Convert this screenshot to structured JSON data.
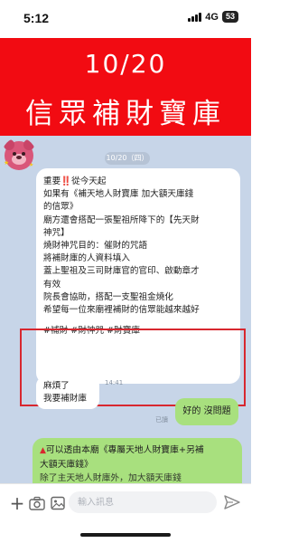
{
  "status_bar": {
    "time": "5:12",
    "network": "4G",
    "battery": "53"
  },
  "banner": {
    "date": "10/20",
    "title": "信眾補財寶庫",
    "background": "#f20b12"
  },
  "chat": {
    "date_label": "10/20（四）",
    "incoming_message": {
      "lines": [
        "重要‼️從今天起",
        "如果有《補天地人財寶庫 加大額天庫錢",
        "的信眾》",
        "廟方還會搭配一張聖祖所降下的【先天財",
        "神咒】",
        "燒財神咒目的：催財的咒語",
        "將補財庫的人資料填入",
        "蓋上聖祖及三司財庫官的官印、啟動章才",
        "有效",
        "院長會協助，搭配一支聖祖金燒化",
        "希望每一位來廟裡補財的信眾能越來越好",
        "#補財 #財神咒 #財寶庫"
      ]
    },
    "incoming_short": {
      "lines": [
        "麻煩了",
        "我要補財庫"
      ],
      "time": "14:41"
    },
    "outgoing_reply": {
      "text": "好的 沒問題",
      "status": "已讀"
    },
    "outgoing_long": {
      "lines": [
        "可以透由本廟《專屬天地人財寶庫+另補",
        "大額天庫錢》",
        "除了主天地人財庫外，加大額天庫錢"
      ]
    },
    "colors": {
      "background": "#c7d5e8",
      "outgoing_bubble": "#a8e07e",
      "highlight": "#d8272f"
    }
  },
  "input_bar": {
    "placeholder": "輸入訊息"
  },
  "icons": {
    "plus": "plus-icon",
    "camera": "camera-icon",
    "image": "image-icon",
    "send": "send-icon",
    "avatar": "strawberry-bear-avatar"
  }
}
